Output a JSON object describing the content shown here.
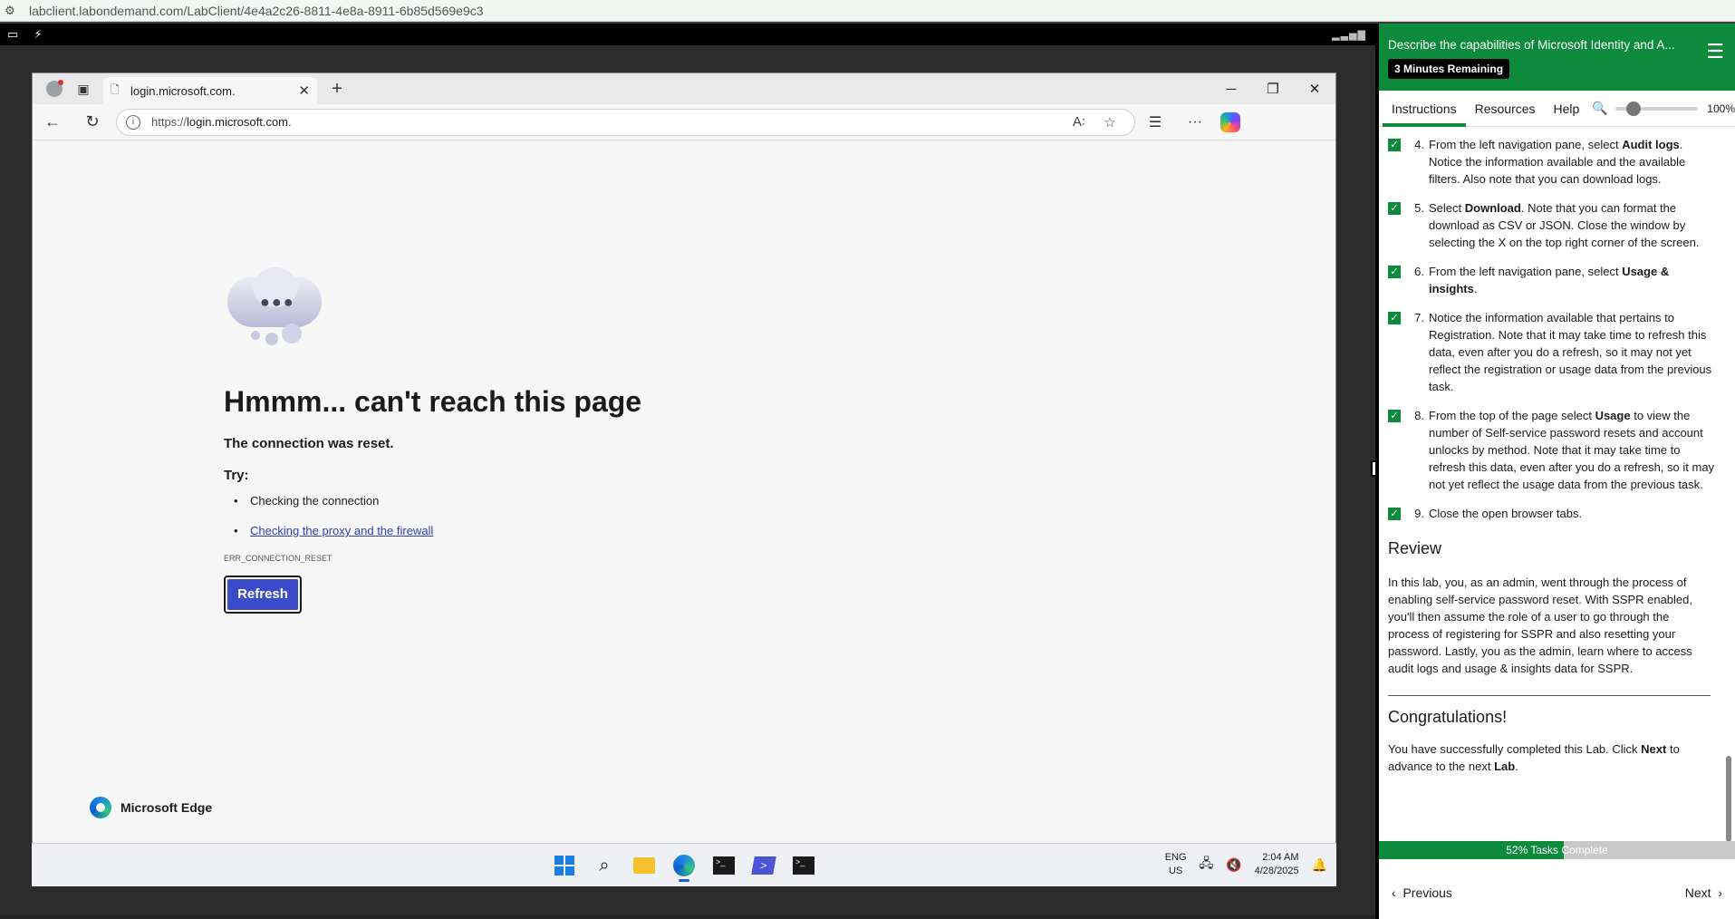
{
  "host": {
    "url": "labclient.labondemand.com/LabClient/4e4a2c26-8811-4e8a-8911-6b85d569e9c3"
  },
  "browser": {
    "tab_title": "login.microsoft.com.",
    "url_prefix": "https://",
    "url_host": "login.microsoft.com."
  },
  "error_page": {
    "title": "Hmmm... can't reach this page",
    "subtitle": "The connection was reset.",
    "try_label": "Try:",
    "suggestions": [
      "Checking the connection",
      "Checking the proxy and the firewall"
    ],
    "code": "ERR_CONNECTION_RESET",
    "refresh_label": "Refresh",
    "brand": "Microsoft Edge"
  },
  "taskbar": {
    "lang_top": "ENG",
    "lang_bottom": "US",
    "time": "2:04 AM",
    "date": "4/28/2025"
  },
  "panel": {
    "title": "Describe the capabilities of Microsoft Identity and A...",
    "timer": "3 Minutes Remaining",
    "tabs": [
      "Instructions",
      "Resources",
      "Help"
    ],
    "zoom": "100%",
    "steps": [
      {
        "num": "4.",
        "pre": "From the left navigation pane, select ",
        "bold": "Audit logs",
        "post": ". Notice the information available and the available filters. Also note that you can download logs."
      },
      {
        "num": "5.",
        "pre": "Select ",
        "bold": "Download",
        "post": ". Note that you can format the download as CSV or JSON. Close the window by selecting the X on the top right corner of the screen."
      },
      {
        "num": "6.",
        "pre": "From the left navigation pane, select ",
        "bold": "Usage & insights",
        "post": "."
      },
      {
        "num": "7.",
        "pre": "",
        "bold": "",
        "post": "Notice the information available that pertains to Registration. Note that it may take time to refresh this data, even after you do a refresh, so it may not yet reflect the registration or usage data from the previous task."
      },
      {
        "num": "8.",
        "pre": "From the top of the page select ",
        "bold": "Usage",
        "post": " to view the number of Self-service password resets and account unlocks by method. Note that it may take time to refresh this data, even after you do a refresh, so it may not yet reflect the usage data from the previous task."
      },
      {
        "num": "9.",
        "pre": "",
        "bold": "",
        "post": "Close the open browser tabs."
      }
    ],
    "review_heading": "Review",
    "review_text": "In this lab, you, as an admin, went through the process of enabling self-service password reset. With SSPR enabled, you'll then assume the role of a user to go through the process of registering for SSPR and also resetting your password. Lastly, you as the admin, learn where to access audit logs and usage & insights data for SSPR.",
    "congrats_heading": "Congratulations!",
    "congrats_pre": "You have successfully completed this Lab. Click ",
    "congrats_next": "Next",
    "congrats_mid": " to advance to the next ",
    "congrats_lab": "Lab",
    "congrats_end": ".",
    "progress_label": "52% Tasks Complete",
    "progress_fraction": 0.52,
    "prev_label": "Previous",
    "next_label": "Next"
  },
  "colors": {
    "accent": "#0d8a3c",
    "refresh": "#3b4cca",
    "link": "#2c3fb8"
  }
}
